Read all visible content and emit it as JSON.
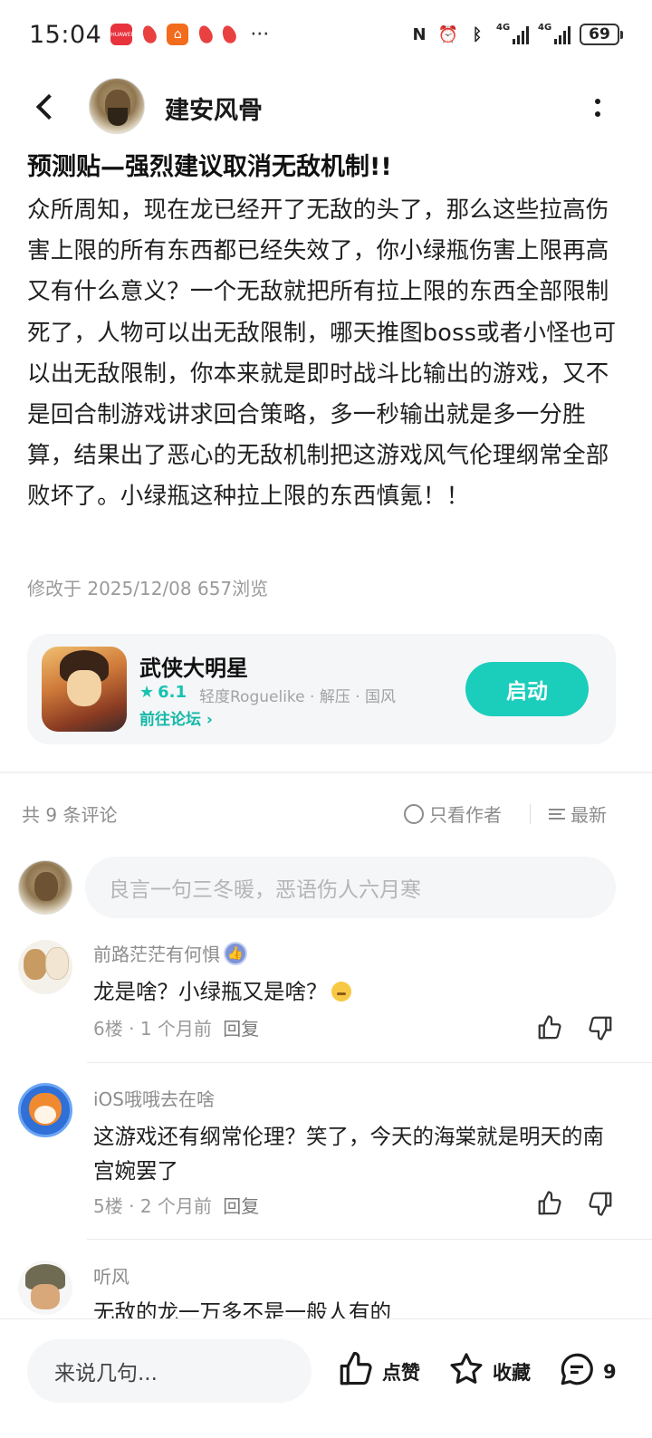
{
  "status_bar": {
    "time": "15:04",
    "notif_app_label": "HUAWEI",
    "more": "···",
    "network_1": "4G",
    "network_2": "4G",
    "battery": "69"
  },
  "header": {
    "author_name": "建安风骨"
  },
  "post": {
    "title": "预测贴—强烈建议取消无敌机制!!",
    "body": "众所周知，现在龙已经开了无敌的头了，那么这些拉高伤害上限的所有东西都已经失效了，你小绿瓶伤害上限再高又有什么意义？一个无敌就把所有拉上限的东西全部限制死了，人物可以出无敌限制，哪天推图boss或者小怪也可以出无敌限制，你本来就是即时战斗比输出的游戏，又不是回合制游戏讲求回合策略，多一秒输出就是多一分胜算，结果出了恶心的无敌机制把这游戏风气伦理纲常全部败坏了。小绿瓶这种拉上限的东西慎氪！！",
    "meta": "修改于 2025/12/08  657浏览"
  },
  "game_card": {
    "name": "武侠大明星",
    "rating": "6.1",
    "tags": "轻度Roguelike · 解压 · 国风",
    "forum_link": "前往论坛",
    "launch_label": "启动",
    "accent": "#1bcdbb"
  },
  "comments_header": {
    "count_label": "共 9 条评论",
    "only_author": "只看作者",
    "sort": "最新"
  },
  "comment_input": {
    "placeholder": "良言一句三冬暖，恶语伤人六月寒"
  },
  "comments": [
    {
      "username": "前路茫茫有何惧",
      "text": "龙是啥？小绿瓶又是啥？",
      "floor": "6楼",
      "time": "1 个月前",
      "reply": "回复",
      "avatar": "dog-avatar",
      "badge": "thumbs-badge-icon"
    },
    {
      "username": "iOS哦哦去在啥",
      "text": "这游戏还有纲常伦理？笑了，今天的海棠就是明天的南宫婉罢了",
      "floor": "5楼",
      "time": "2 个月前",
      "reply": "回复",
      "avatar": "shiba-avatar"
    },
    {
      "username": "听风",
      "text": "无敌的龙一万多不是一般人有的",
      "avatar": "soldier-avatar"
    }
  ],
  "bottom_bar": {
    "input_placeholder": "来说几句...",
    "like_label": "点赞",
    "favorite_label": "收藏",
    "comment_count": "9"
  }
}
